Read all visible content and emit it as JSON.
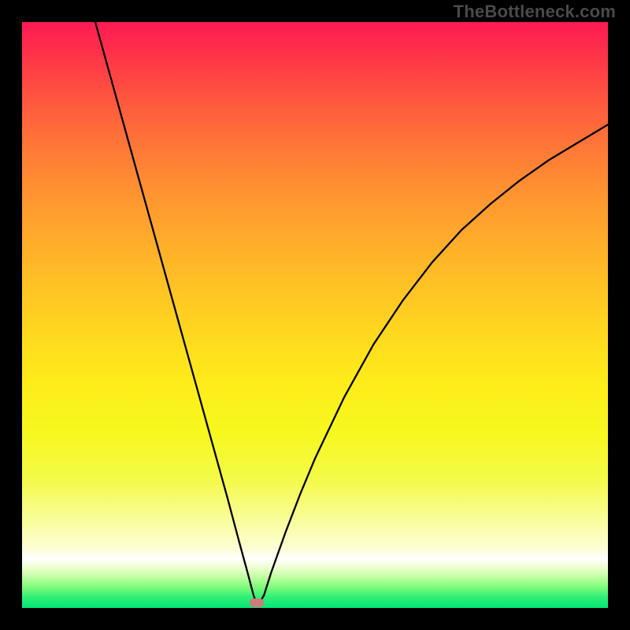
{
  "watermark": "TheBottleneck.com",
  "chart_data": {
    "type": "line",
    "title": "",
    "xlabel": "",
    "ylabel": "",
    "x_range": [
      0,
      100
    ],
    "y_range": [
      0,
      100
    ],
    "comment": "Bottleneck curve: y is bottleneck percentage (approx 0–100). Minimum (optimal match) lies near x≈40. x and y are normalized 0–100; axes are hidden in the image so values are estimated from the curve geometry.",
    "series": [
      {
        "name": "bottleneck-curve",
        "x": [
          12.5,
          15,
          17.5,
          20,
          22.5,
          25,
          27.5,
          30,
          32.5,
          35,
          37,
          38.5,
          39.5,
          40,
          40.5,
          41.3,
          42.5,
          45,
          47.5,
          50,
          55,
          60,
          65,
          70,
          75,
          80,
          85,
          90,
          95,
          100
        ],
        "y": [
          100,
          91,
          82,
          73,
          64,
          55,
          46,
          37,
          28,
          19,
          11.5,
          6,
          2.2,
          0.8,
          0.8,
          2.2,
          6,
          13,
          19.5,
          25.5,
          36,
          45,
          52.5,
          59,
          64.5,
          69,
          73,
          76.5,
          79.5,
          82.5
        ]
      }
    ],
    "optimal_point": {
      "x": 40,
      "y": 0.8
    },
    "background_gradient": {
      "top": "#ff1a54",
      "middle": "#ffe81c",
      "bottom": "#00e773"
    },
    "marker_color": "#d07b7b"
  }
}
